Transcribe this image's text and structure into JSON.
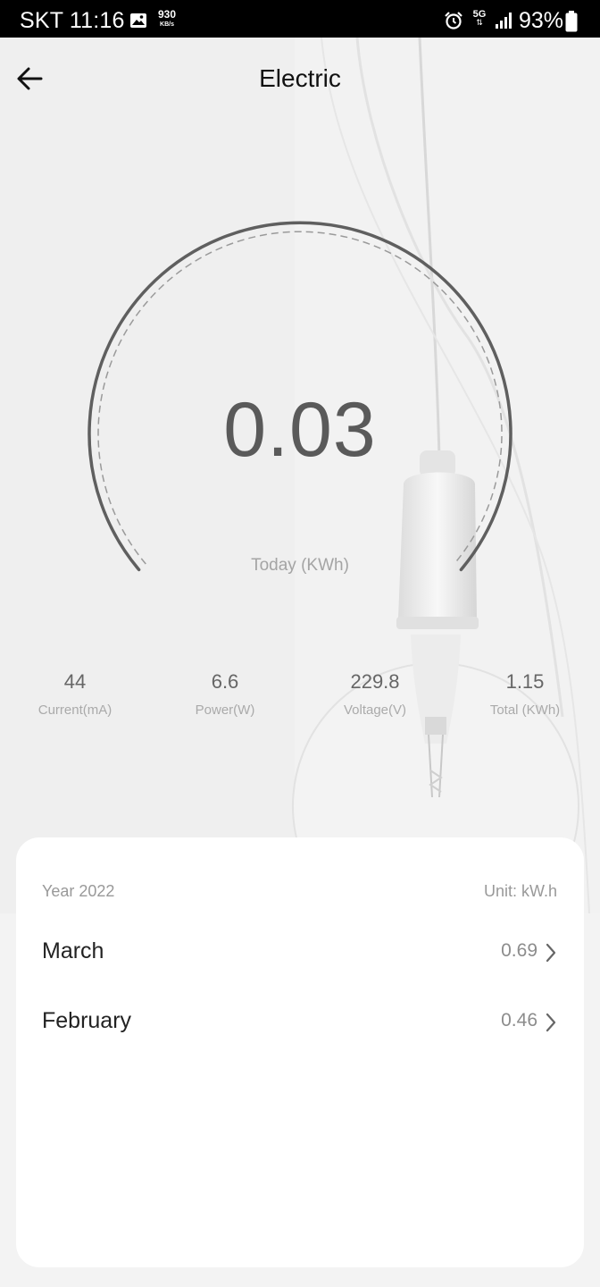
{
  "status_bar": {
    "carrier_time": "SKT 11:16",
    "speed_value": "930",
    "speed_unit": "KB/s",
    "network": "5G",
    "network_arrows": "⇅",
    "battery": "93%",
    "icons": [
      "gallery-icon",
      "alarm-icon",
      "signal-icon",
      "battery-icon"
    ]
  },
  "header": {
    "title": "Electric",
    "back_icon": "arrow-left-icon"
  },
  "gauge": {
    "value": "0.03",
    "caption": "Today (KWh)",
    "ring_color": "#5f5f5f"
  },
  "stats": [
    {
      "value": "44",
      "label": "Current(mA)"
    },
    {
      "value": "6.6",
      "label": "Power(W)"
    },
    {
      "value": "229.8",
      "label": "Voltage(V)"
    },
    {
      "value": "1.15",
      "label": "Total (KWh)"
    }
  ],
  "history": {
    "year": "Year 2022",
    "unit": "Unit: kW.h",
    "months": [
      {
        "name": "March",
        "value": "0.69"
      },
      {
        "name": "February",
        "value": "0.46"
      }
    ],
    "chevron_icon": "chevron-right-icon"
  }
}
